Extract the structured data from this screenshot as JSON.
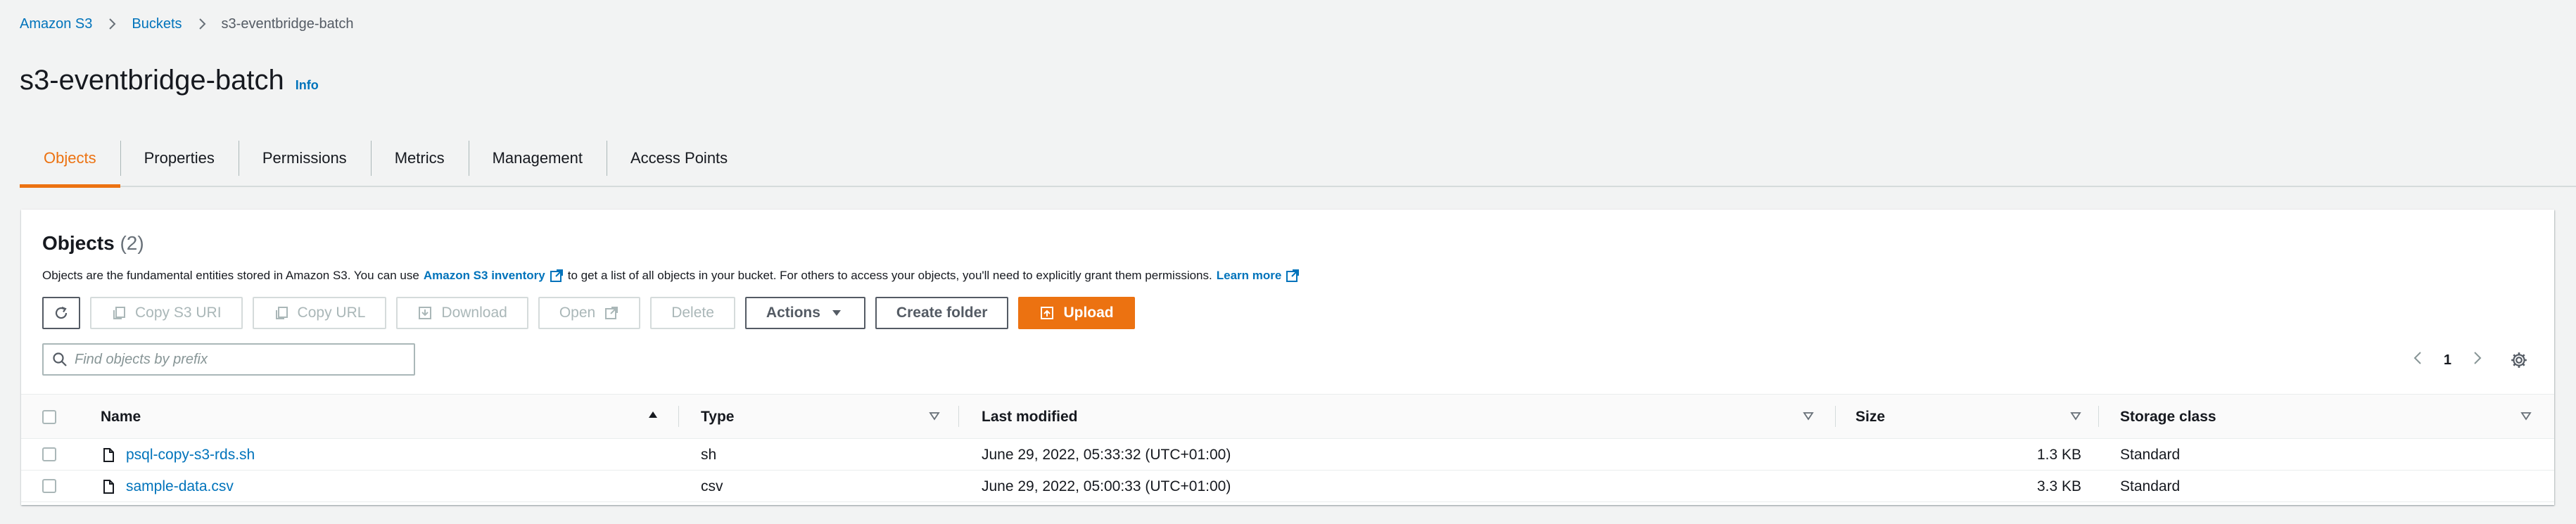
{
  "breadcrumb": {
    "items": [
      "Amazon S3",
      "Buckets"
    ],
    "current": "s3-eventbridge-batch"
  },
  "page": {
    "title": "s3-eventbridge-batch",
    "info_label": "Info"
  },
  "tabs": [
    "Objects",
    "Properties",
    "Permissions",
    "Metrics",
    "Management",
    "Access Points"
  ],
  "objects_panel": {
    "heading": "Objects",
    "count": "(2)",
    "desc_part1": "Objects are the fundamental entities stored in Amazon S3. You can use",
    "inventory_link": "Amazon S3 inventory",
    "desc_part2": "to get a list of all objects in your bucket. For others to access your objects, you'll need to explicitly grant them permissions.",
    "learn_more": "Learn more"
  },
  "toolbar": {
    "copy_uri": "Copy S3 URI",
    "copy_url": "Copy URL",
    "download": "Download",
    "open": "Open",
    "delete": "Delete",
    "actions": "Actions",
    "create_folder": "Create folder",
    "upload": "Upload"
  },
  "search": {
    "placeholder": "Find objects by prefix"
  },
  "pagination": {
    "page": "1"
  },
  "table": {
    "columns": [
      "Name",
      "Type",
      "Last modified",
      "Size",
      "Storage class"
    ],
    "rows": [
      {
        "name": "psql-copy-s3-rds.sh",
        "type": "sh",
        "modified": "June 29, 2022, 05:33:32 (UTC+01:00)",
        "size": "1.3 KB",
        "storage": "Standard"
      },
      {
        "name": "sample-data.csv",
        "type": "csv",
        "modified": "June 29, 2022, 05:00:33 (UTC+01:00)",
        "size": "3.3 KB",
        "storage": "Standard"
      }
    ]
  },
  "colors": {
    "accent": "#ec7211",
    "link": "#0073bb",
    "text": "#16191f"
  }
}
